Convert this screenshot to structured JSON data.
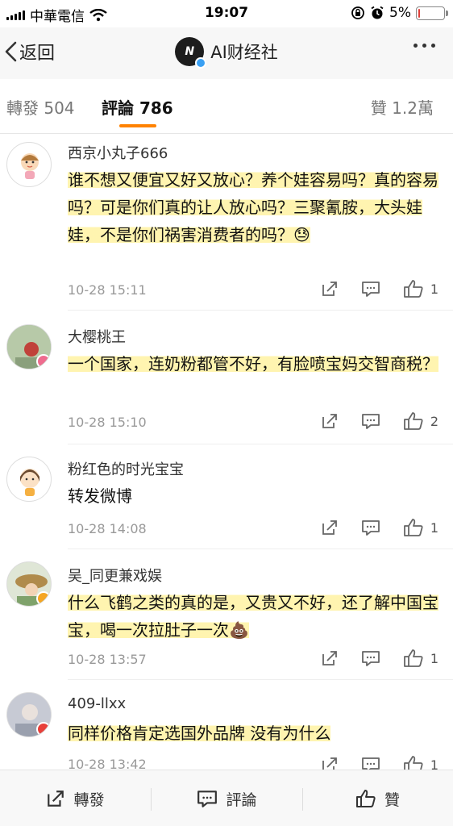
{
  "status_bar": {
    "carrier": "中華電信",
    "time": "19:07",
    "battery": "5%",
    "battery_level": 0.05
  },
  "nav": {
    "back_label": "返回",
    "title": "AI财经社",
    "logo_text": "N"
  },
  "tabs": {
    "repost": "轉發 504",
    "comment": "評論 786",
    "like": "贊 1.2萬"
  },
  "comments": [
    {
      "user": "西京小丸子666",
      "text": "谁不想又便宜又好又放心？养个娃容易吗？真的容易吗？可是你们真的让人放心吗？三聚氰胺，大头娃娃，不是你们祸害消费者的吗？😓",
      "time": "10-28 15:11",
      "likes": "1"
    },
    {
      "user": "大樱桃王",
      "text": "一个国家，连奶粉都管不好，有脸喷宝妈交智商税？",
      "time": "10-28 15:10",
      "likes": "2"
    },
    {
      "user": "粉红色的时光宝宝",
      "text": "转发微博",
      "time": "10-28 14:08",
      "likes": "1"
    },
    {
      "user": "吴_同更兼戏娱",
      "text": "什么飞鹤之类的真的是，又贵又不好，还了解中国宝宝，喝一次拉肚子一次💩",
      "time": "10-28 13:57",
      "likes": "1"
    },
    {
      "user": "409-llxx",
      "text": "同样价格肯定选国外品牌 没有为什么",
      "time": "10-28 13:42",
      "likes": "1"
    }
  ],
  "bottom_bar": {
    "repost": "轉發",
    "comment": "評論",
    "like": "贊"
  },
  "colors": {
    "accent": "#ff8200",
    "highlight": "#fff196",
    "verified_blue": "#3aa0f3",
    "badge_orange": "#f5a623",
    "badge_red": "#e8403a",
    "badge_pink": "#ef6c8f"
  },
  "icons": [
    "wifi-icon",
    "signal-icon",
    "orientation-lock-icon",
    "alarm-icon",
    "battery-icon",
    "chevron-left-icon",
    "more-icon",
    "share-icon",
    "comment-icon",
    "like-icon"
  ]
}
